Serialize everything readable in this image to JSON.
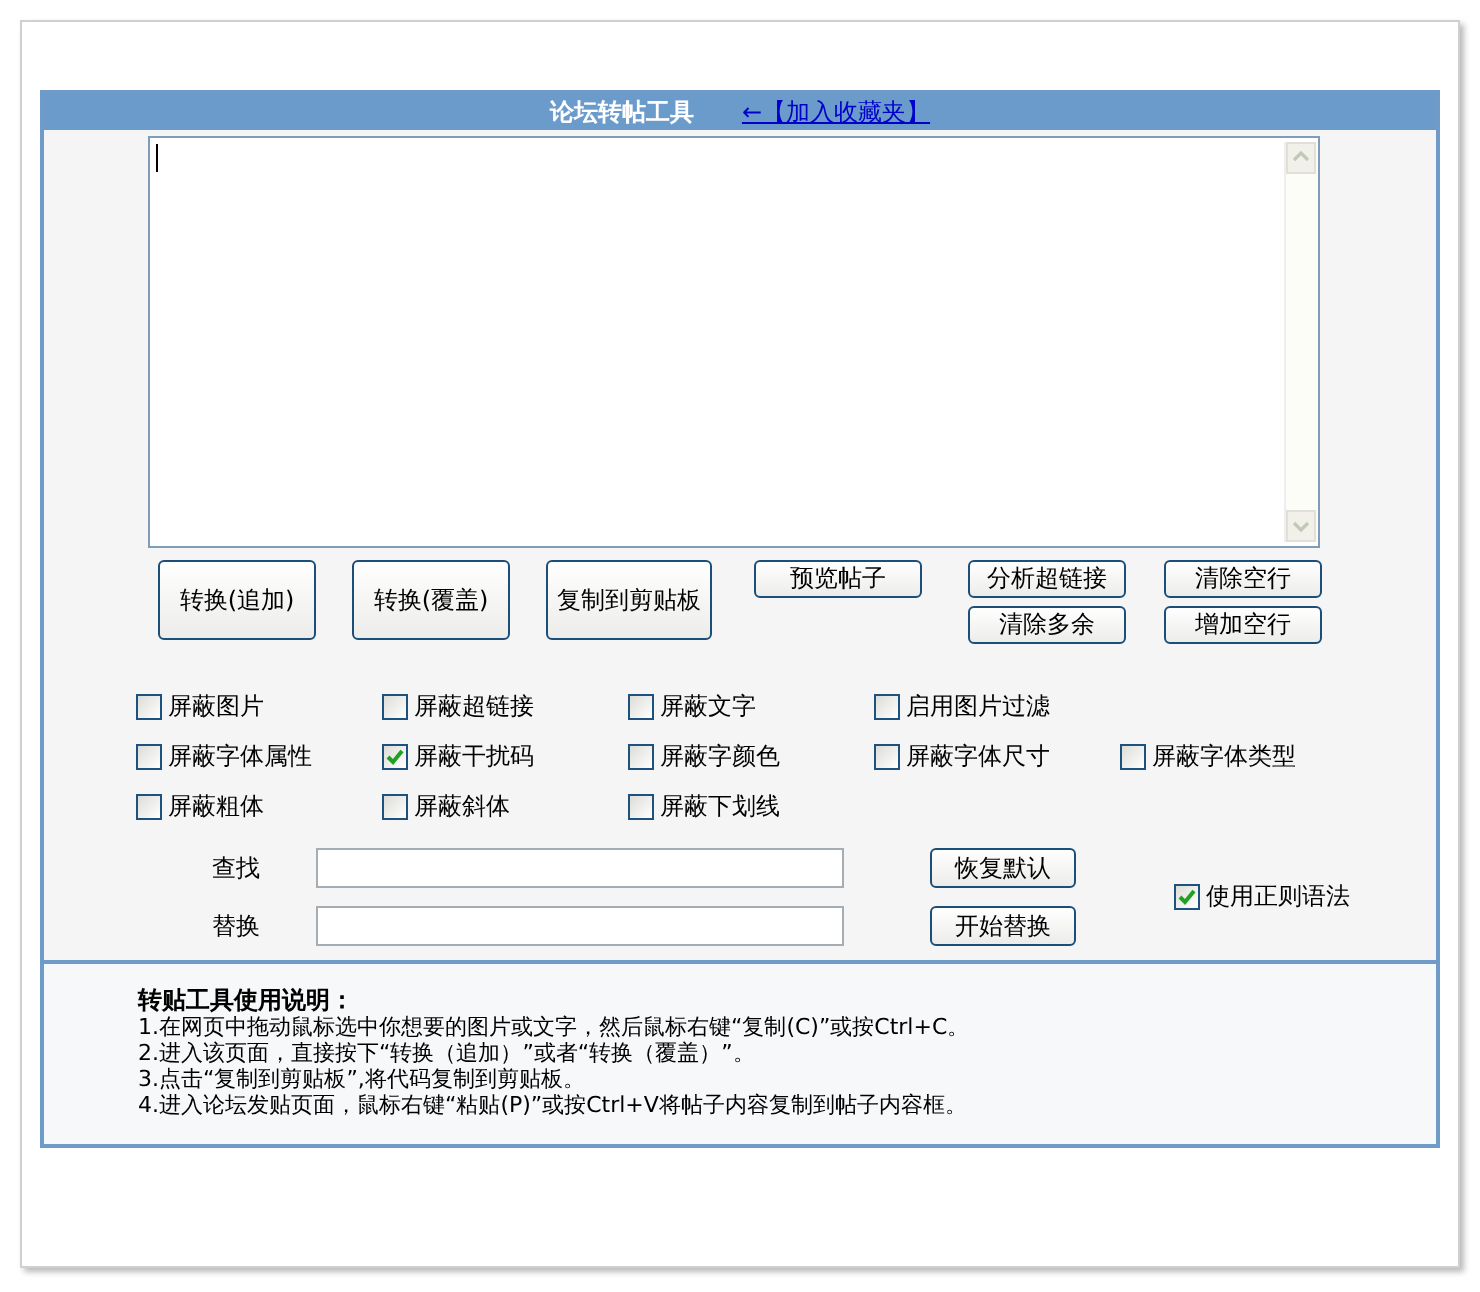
{
  "header": {
    "title": "论坛转帖工具",
    "link": "←【加入收藏夹】"
  },
  "large_buttons": [
    "转换(追加)",
    "转换(覆盖)",
    "复制到剪贴板"
  ],
  "small_button_columns": [
    [
      "预览帖子"
    ],
    [
      "分析超链接",
      "清除多余"
    ],
    [
      "清除空行",
      "增加空行"
    ]
  ],
  "filter_rows": [
    [
      {
        "label": "屏蔽图片",
        "checked": false
      },
      {
        "label": "屏蔽超链接",
        "checked": false
      },
      {
        "label": "屏蔽文字",
        "checked": false
      },
      {
        "label": "启用图片过滤",
        "checked": false
      }
    ],
    [
      {
        "label": "屏蔽字体属性",
        "checked": false
      },
      {
        "label": "屏蔽干扰码",
        "checked": true
      },
      {
        "label": "屏蔽字颜色",
        "checked": false
      },
      {
        "label": "屏蔽字体尺寸",
        "checked": false
      },
      {
        "label": "屏蔽字体类型",
        "checked": false
      }
    ],
    [
      {
        "label": "屏蔽粗体",
        "checked": false
      },
      {
        "label": "屏蔽斜体",
        "checked": false
      },
      {
        "label": "屏蔽下划线",
        "checked": false
      }
    ]
  ],
  "find_replace": {
    "find_label": "查找",
    "replace_label": "替换",
    "buttons": [
      "恢复默认",
      "开始替换"
    ],
    "regex": {
      "label": "使用正则语法",
      "checked": true
    }
  },
  "instructions": {
    "title": "转贴工具使用说明：",
    "lines": [
      "1.在网页中拖动鼠标选中你想要的图片或文字，然后鼠标右键“复制(C)”或按Ctrl+C。",
      "2.进入该页面，直接按下“转换（追加）”或者“转换（覆盖）”。",
      "3.点击“复制到剪贴板”,将代码复制到剪贴板。",
      "4.进入论坛发贴页面，鼠标右键“粘贴(P)”或按Ctrl+V将帖子内容复制到帖子内容框。"
    ]
  }
}
